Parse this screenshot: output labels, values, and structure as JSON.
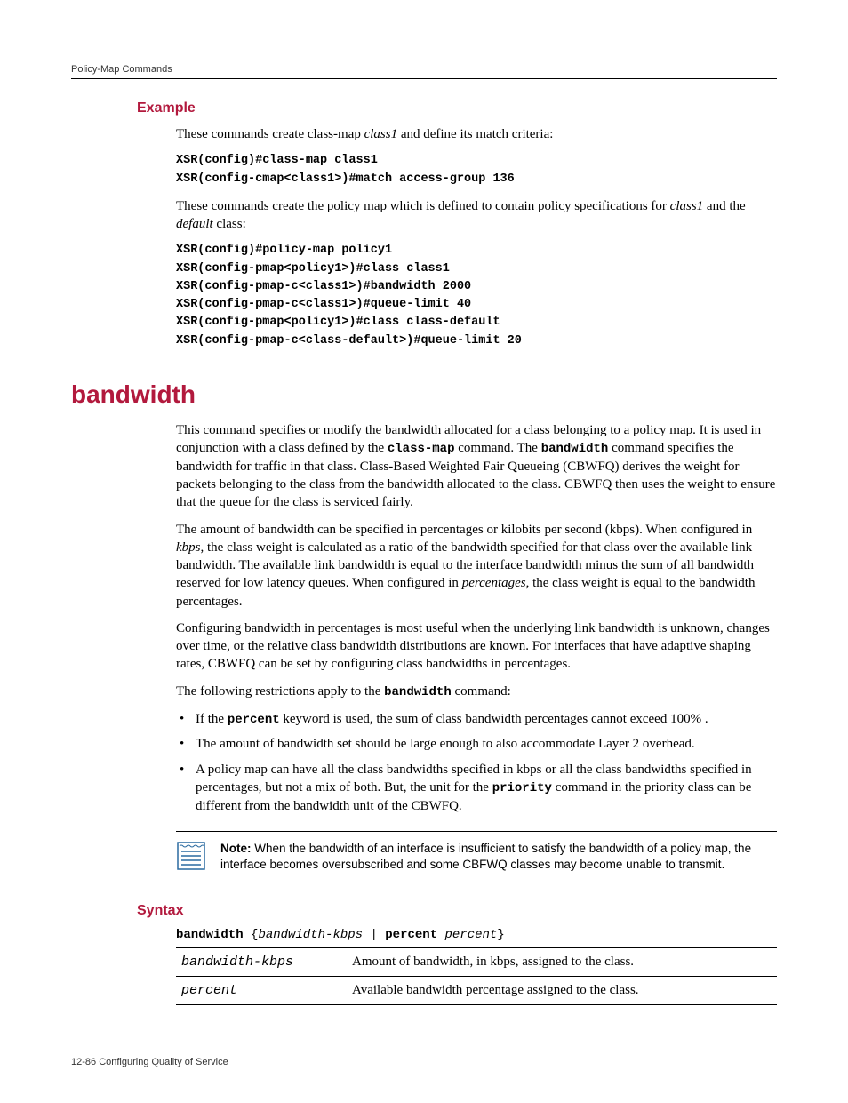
{
  "running_head": "Policy-Map Commands",
  "sections": {
    "example": {
      "heading": "Example",
      "intro1_pre": "These commands create class-map ",
      "intro1_em": "class1",
      "intro1_post": " and define its match criteria:",
      "code1": "XSR(config)#class-map class1\nXSR(config-cmap<class1>)#match access-group 136",
      "intro2_pre": "These commands create the policy map which is defined to contain policy specifications for ",
      "intro2_em1": "class1",
      "intro2_mid": " and the ",
      "intro2_em2": "default",
      "intro2_post": " class:",
      "code2": "XSR(config)#policy-map policy1\nXSR(config-pmap<policy1>)#class class1\nXSR(config-pmap-c<class1>)#bandwidth 2000\nXSR(config-pmap-c<class1>)#queue-limit 40\nXSR(config-pmap<policy1>)#class class-default\nXSR(config-pmap-c<class-default>)#queue-limit 20"
    },
    "bandwidth": {
      "heading": "bandwidth",
      "p1_a": "This command specifies or modify the bandwidth allocated for a class belonging to a policy map. It is used in conjunction with a class defined by the ",
      "p1_mono1": "class-map",
      "p1_b": " command. The ",
      "p1_mono2": "bandwidth",
      "p1_c": " command specifies the bandwidth for traffic in that class. Class-Based Weighted Fair Queueing (CBWFQ) derives the weight for packets belonging to the class from the bandwidth allocated to the class. CBWFQ then uses the weight to ensure that the queue for the class is serviced fairly.",
      "p2_a": "The amount of bandwidth can be specified in percentages or kilobits per second (kbps). When configured in ",
      "p2_em1": "kbps",
      "p2_b": ", the class weight is calculated as a ratio of the bandwidth specified for that class over the available link bandwidth. The available link bandwidth is equal to the interface bandwidth minus the sum of all bandwidth reserved for low latency queues. When configured in ",
      "p2_em2": "percentages",
      "p2_c": ", the class weight is equal to the bandwidth percentages.",
      "p3": "Configuring bandwidth in percentages is most useful when the underlying link bandwidth is unknown, changes over time, or the relative class bandwidth distributions are known. For interfaces that have adaptive shaping rates, CBWFQ can be set by configuring class bandwidths in percentages.",
      "p4_a": "The following restrictions apply to the ",
      "p4_mono": "bandwidth",
      "p4_b": " command:",
      "bullets": {
        "b1_a": "If the ",
        "b1_mono": "percent",
        "b1_b": " keyword is used, the sum of class bandwidth percentages cannot exceed 100% .",
        "b2": "The amount of bandwidth set should be large enough to also accommodate Layer 2 overhead.",
        "b3_a": "A policy map can have all the class bandwidths specified in kbps or all the class bandwidths specified in percentages, but not a mix of both. But, the unit for the ",
        "b3_mono": "priority",
        "b3_b": " command in the priority class can be different from the bandwidth unit of the CBWFQ."
      },
      "note_label": "Note:",
      "note_text": " When the bandwidth of an interface is insufficient to satisfy the bandwidth of a policy map, the interface becomes oversubscribed and some CBFWQ classes may become unable to transmit."
    },
    "syntax": {
      "heading": "Syntax",
      "line": {
        "kw1": "bandwidth",
        "brace_open": " {",
        "arg1": "bandwidth-kbps",
        "pipe": " | ",
        "kw2": "percent",
        "sp": " ",
        "arg2": "percent",
        "brace_close": "}"
      },
      "params": [
        {
          "name": "bandwidth-kbps",
          "desc": "Amount of bandwidth, in kbps, assigned to the class."
        },
        {
          "name": "percent",
          "desc": "Available bandwidth percentage assigned to the class."
        }
      ]
    }
  },
  "footer": "12-86   Configuring Quality of Service"
}
